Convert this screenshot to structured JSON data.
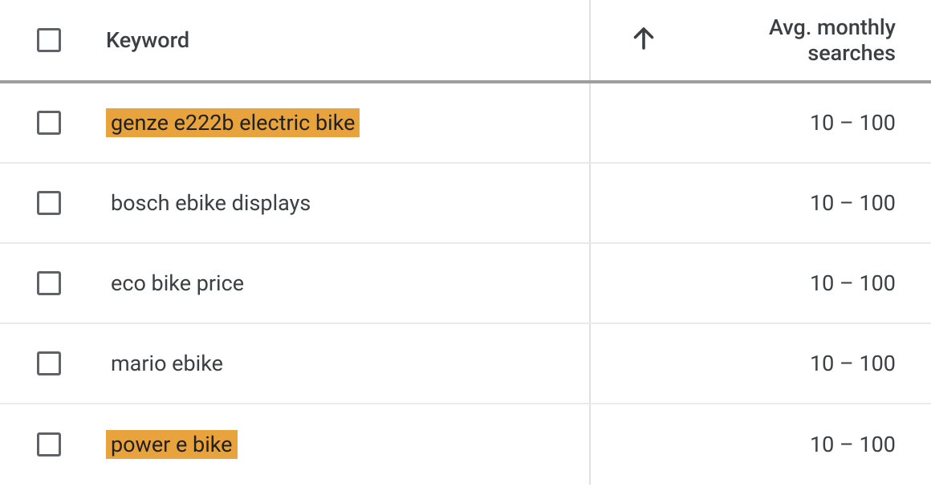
{
  "table": {
    "columns": {
      "keyword": "Keyword",
      "searches_line1": "Avg. monthly",
      "searches_line2": "searches"
    },
    "rows": [
      {
        "keyword": "genze e222b electric bike",
        "highlighted": true,
        "avg_monthly_searches": "10 – 100"
      },
      {
        "keyword": "bosch ebike displays",
        "highlighted": false,
        "avg_monthly_searches": "10 – 100"
      },
      {
        "keyword": "eco bike price",
        "highlighted": false,
        "avg_monthly_searches": "10 – 100"
      },
      {
        "keyword": "mario ebike",
        "highlighted": false,
        "avg_monthly_searches": "10 – 100"
      },
      {
        "keyword": "power e bike",
        "highlighted": true,
        "avg_monthly_searches": "10 – 100"
      }
    ]
  }
}
